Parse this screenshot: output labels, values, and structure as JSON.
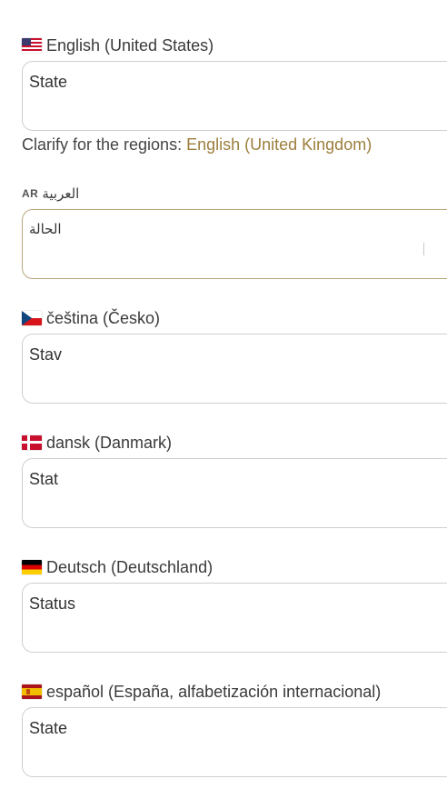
{
  "languages": [
    {
      "name": "English (United States)",
      "icon": "us-flag-icon",
      "value": "State",
      "clarify_prefix": "Clarify for the regions:",
      "clarify_link": "English (United Kingdom)"
    },
    {
      "name": "العربية",
      "badge": "AR",
      "value": "الحالة"
    },
    {
      "name": "čeština (Česko)",
      "icon": "czech-flag-icon",
      "value": "Stav"
    },
    {
      "name": "dansk (Danmark)",
      "icon": "danish-flag-icon",
      "value": "Stat"
    },
    {
      "name": "Deutsch (Deutschland)",
      "icon": "german-flag-icon",
      "value": "Status"
    },
    {
      "name": "español (España, alfabetización internacional)",
      "icon": "spanish-flag-icon",
      "value": "State"
    }
  ],
  "colors": {
    "accent_link": "#9c7e3c",
    "active_border": "#b9a77c",
    "field_border": "#cfcfcf"
  }
}
